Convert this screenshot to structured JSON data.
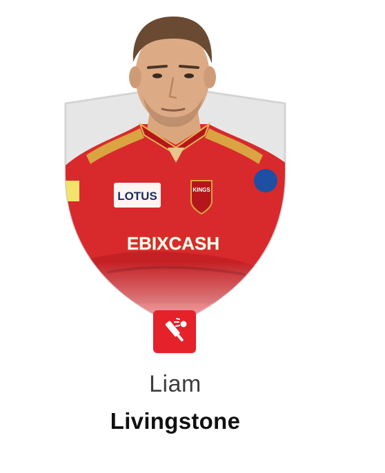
{
  "player": {
    "first_name": "Liam",
    "last_name": "Livingstone",
    "role_icon": "batsman-icon",
    "jersey_sponsor_1": "LOTUS",
    "jersey_sponsor_2": "EBIXCASH",
    "team_badge": "KINGS"
  },
  "colors": {
    "badge": "#e5212a",
    "shield": "#e6e6e6",
    "jersey": "#d82a2c"
  }
}
